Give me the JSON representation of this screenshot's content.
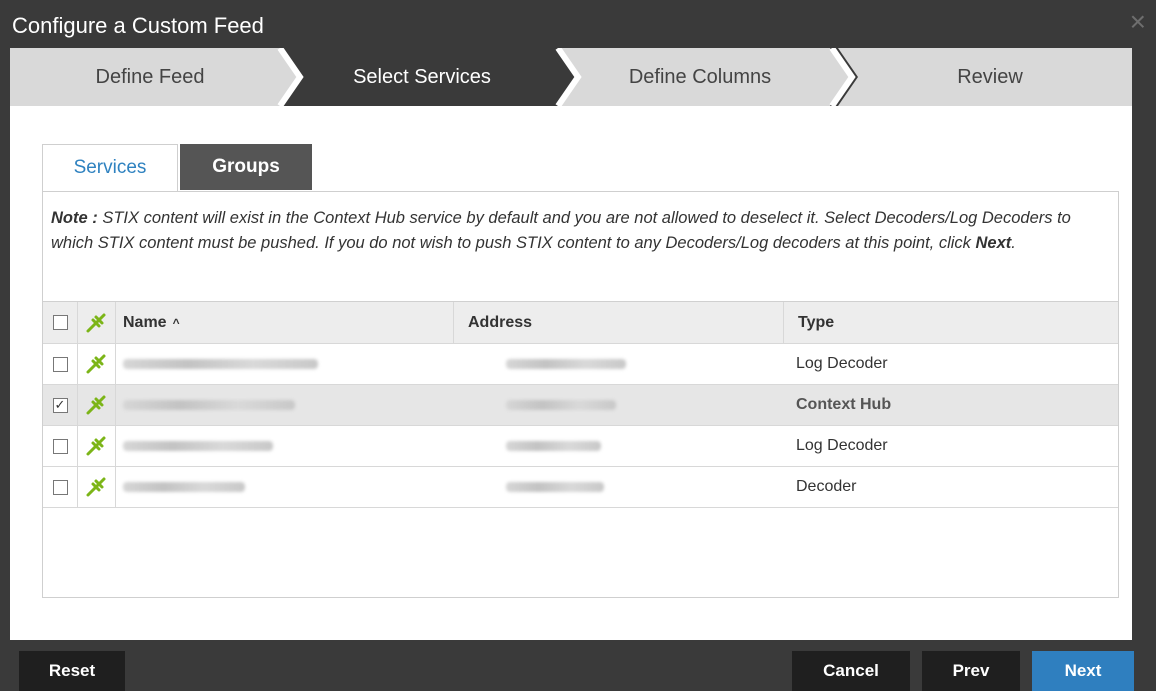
{
  "dialog": {
    "title": "Configure a Custom Feed",
    "close_glyph": "×"
  },
  "wizard": {
    "steps": [
      {
        "label": "Define Feed",
        "active": false
      },
      {
        "label": "Select Services",
        "active": true
      },
      {
        "label": "Define Columns",
        "active": false
      },
      {
        "label": "Review",
        "active": false
      }
    ]
  },
  "tabs": {
    "services": "Services",
    "groups": "Groups"
  },
  "note": {
    "prefix": "Note :",
    "text": " STIX content will exist in the Context Hub service by default and you are not allowed to deselect it. Select Decoders/Log Decoders to which STIX content must be pushed. If you do not wish to push STIX content to any Decoders/Log decoders at this point, click ",
    "link": "Next",
    "suffix": "."
  },
  "table": {
    "headers": {
      "name": "Name",
      "sort_indicator": "^",
      "address": "Address",
      "type": "Type"
    },
    "rows": [
      {
        "checked": false,
        "type": "Log Decoder",
        "selected": false
      },
      {
        "checked": true,
        "type": "Context Hub",
        "selected": true
      },
      {
        "checked": false,
        "type": "Log Decoder",
        "selected": false
      },
      {
        "checked": false,
        "type": "Decoder",
        "selected": false
      }
    ]
  },
  "footer": {
    "reset": "Reset",
    "cancel": "Cancel",
    "prev": "Prev",
    "next": "Next"
  },
  "colors": {
    "accent": "#2f7fbf",
    "icon_green": "#7cb518",
    "wizard_active": "#3a3a3a",
    "wizard_inactive": "#d9d9d9"
  }
}
